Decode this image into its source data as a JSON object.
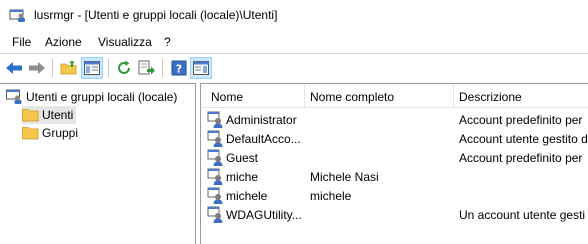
{
  "window": {
    "title": "lusrmgr - [Utenti e gruppi locali (locale)\\Utenti]"
  },
  "menu": {
    "items": [
      "File",
      "Azione",
      "Visualizza",
      "?"
    ]
  },
  "toolbar": {
    "icons": [
      "back-arrow-icon",
      "forward-arrow-icon",
      "up-folder-icon",
      "show-hide-tree-icon",
      "refresh-icon",
      "export-list-icon",
      "help-icon",
      "show-hide-action-pane-icon"
    ]
  },
  "tree": {
    "root": "Utenti e gruppi locali (locale)",
    "children": [
      "Utenti",
      "Gruppi"
    ],
    "selected": "Utenti"
  },
  "list": {
    "columns": [
      "Nome",
      "Nome completo",
      "Descrizione"
    ],
    "rows": [
      {
        "name": "Administrator",
        "full_name": "",
        "description": "Account predefinito per"
      },
      {
        "name": "DefaultAcco...",
        "full_name": "",
        "description": "Account utente gestito d"
      },
      {
        "name": "Guest",
        "full_name": "",
        "description": "Account predefinito per"
      },
      {
        "name": "miche",
        "full_name": "Michele Nasi",
        "description": ""
      },
      {
        "name": "michele",
        "full_name": "michele",
        "description": ""
      },
      {
        "name": "WDAGUtility...",
        "full_name": "",
        "description": "Un account utente gesti"
      }
    ]
  },
  "colors": {
    "accent_blue": "#2f6fd0",
    "selection": "#e5e5e5",
    "toolbar_active": "#cce8ff",
    "folder_yellow": "#f4c64a"
  }
}
